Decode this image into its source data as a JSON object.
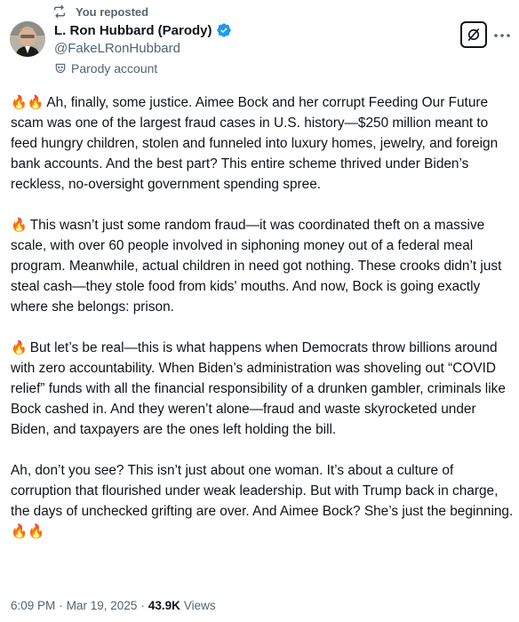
{
  "repost": {
    "label": "You reposted"
  },
  "author": {
    "name": "L. Ron Hubbard (Parody)",
    "handle": "@FakeLRonHubbard",
    "badge": "Parody account"
  },
  "post": {
    "paragraphs": [
      {
        "emoji": "🔥🔥",
        "text": "Ah, finally, some justice. Aimee Bock and her corrupt Feeding Our Future scam was one of the largest fraud cases in U.S. history—$250 million meant to feed hungry children, stolen and funneled into luxury homes, jewelry, and foreign bank accounts. And the best part? This entire scheme thrived under Biden’s reckless, no-oversight government spending spree."
      },
      {
        "emoji": "🔥",
        "text": "This wasn’t just some random fraud—it was coordinated theft on a massive scale, with over 60 people involved in siphoning money out of a federal meal program. Meanwhile, actual children in need got nothing. These crooks didn’t just steal cash—they stole food from kids' mouths. And now, Bock is going exactly where she belongs: prison."
      },
      {
        "emoji": "🔥",
        "text": "But let’s be real—this is what happens when Democrats throw billions around with zero accountability. When Biden’s administration was shoveling out “COVID relief” funds with all the financial responsibility of a drunken gambler, criminals like Bock cashed in. And they weren’t alone—fraud and waste skyrocketed under Biden, and taxpayers are the ones left holding the bill."
      },
      {
        "emoji": "",
        "text": "Ah, don’t you see? This isn’t just about one woman. It’s about a culture of corruption that flourished under weak leadership. But with Trump back in charge, the days of unchecked grifting are over. And Aimee Bock? She’s just the beginning. ",
        "trailing_emoji": "🔥🔥"
      }
    ]
  },
  "meta": {
    "time": "6:09 PM",
    "sep1": "·",
    "date": "Mar 19, 2025",
    "sep2": "·",
    "views_count": "43.9K",
    "views_label": "Views"
  },
  "colors": {
    "verified": "#1d9bf0",
    "muted": "#536471",
    "text": "#0f1419"
  },
  "icons": [
    "repost-icon",
    "verified-badge-icon",
    "parody-mask-icon",
    "grok-icon",
    "more-icon"
  ]
}
